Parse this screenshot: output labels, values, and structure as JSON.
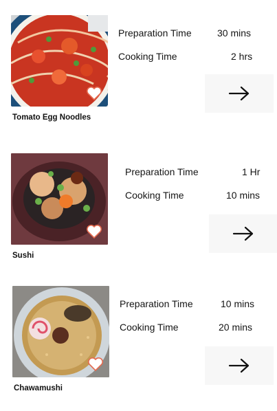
{
  "recipes": [
    {
      "name": "Tomato Egg Noodles",
      "prep_label": "Preparation Time",
      "prep_value": "30 mins",
      "cook_label": "Cooking Time",
      "cook_value": "2 hrs",
      "image_icon": "tomato-egg-noodles-photo",
      "favorite_icon": "heart-icon",
      "go_icon": "arrow-right-icon"
    },
    {
      "name": "Sushi",
      "prep_label": "Preparation Time",
      "prep_value": "1 Hr",
      "cook_label": "Cooking Time",
      "cook_value": "10 mins",
      "image_icon": "sushi-photo",
      "favorite_icon": "heart-icon",
      "go_icon": "arrow-right-icon"
    },
    {
      "name": "Chawamushi",
      "prep_label": "Preparation Time",
      "prep_value": "10 mins",
      "cook_label": "Cooking Time",
      "cook_value": "20 mins",
      "image_icon": "chawamushi-photo",
      "favorite_icon": "heart-icon",
      "go_icon": "arrow-right-icon"
    }
  ],
  "colors": {
    "heart_stroke": "#e46a4f",
    "arrow_bg": "#f7f7f7",
    "text": "#141414"
  }
}
